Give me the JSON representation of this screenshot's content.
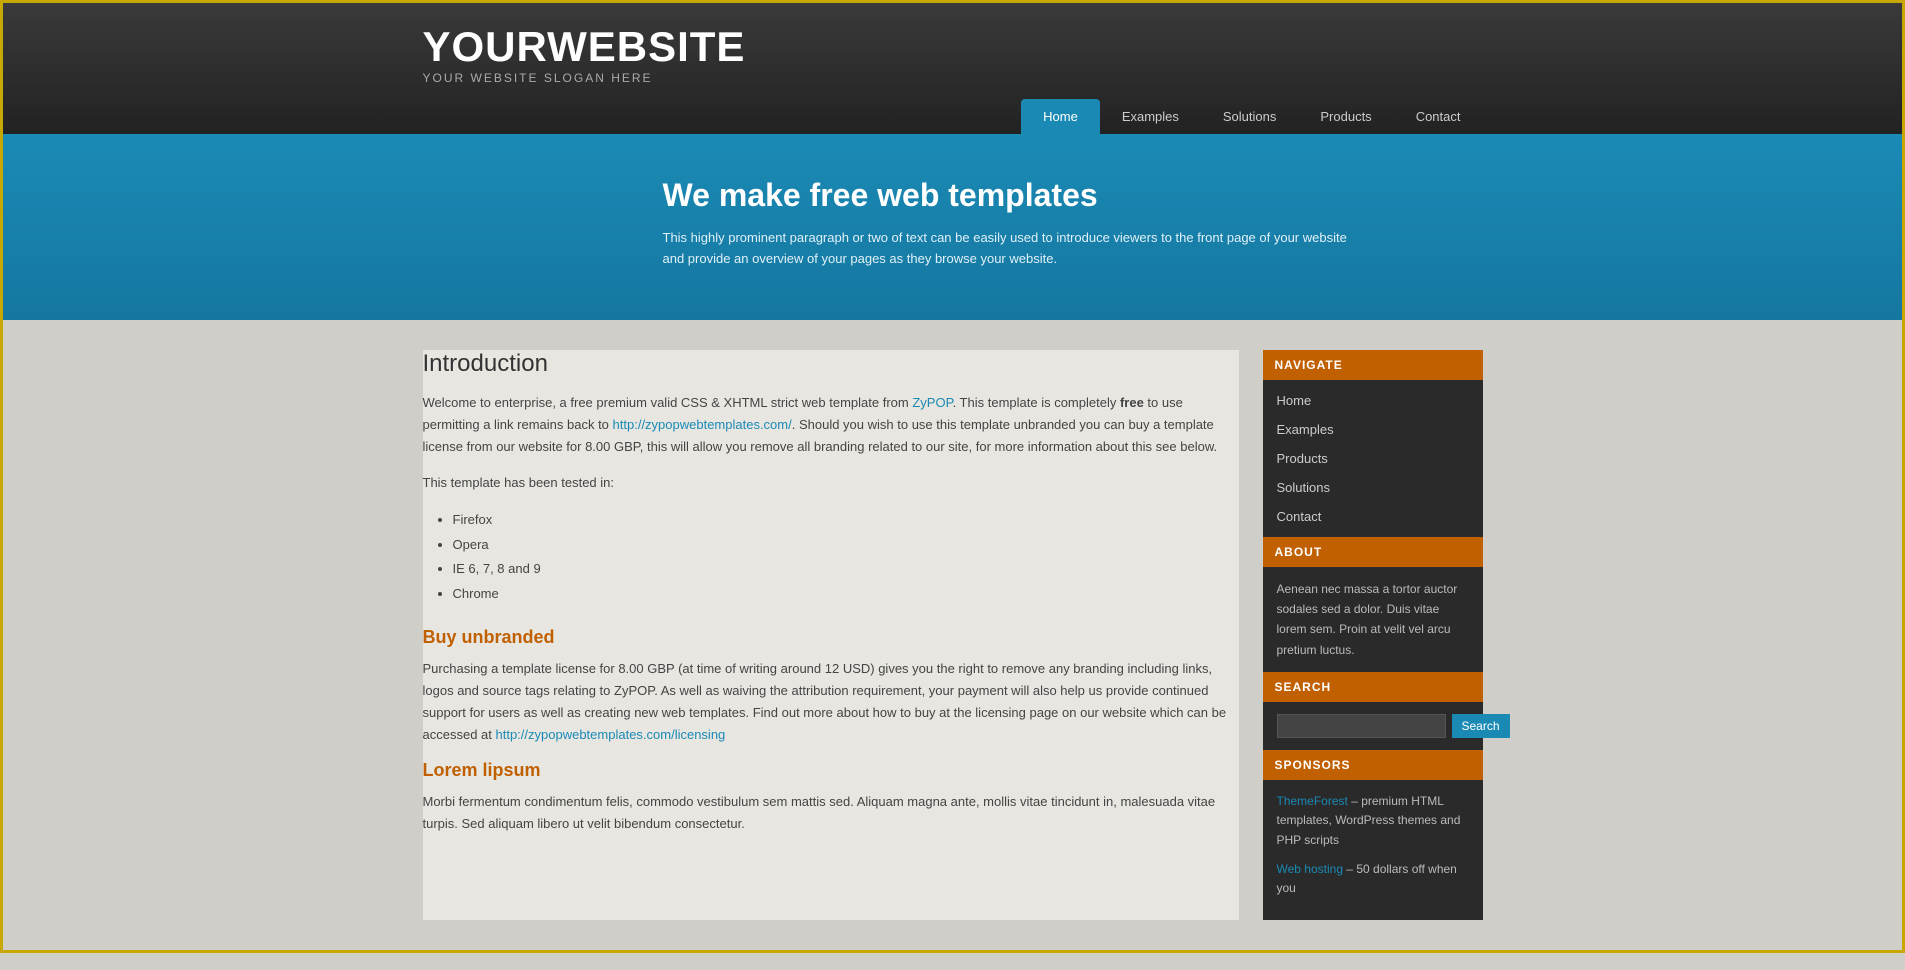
{
  "site": {
    "title": "YOURWEBSITE",
    "slogan": "YOUR WEBSITE SLOGAN HERE"
  },
  "nav": {
    "items": [
      {
        "label": "Home",
        "active": true
      },
      {
        "label": "Examples",
        "active": false
      },
      {
        "label": "Solutions",
        "active": false
      },
      {
        "label": "Products",
        "active": false
      },
      {
        "label": "Contact",
        "active": false
      }
    ]
  },
  "hero": {
    "title": "We make free web templates",
    "text": "This highly prominent paragraph or two of text can be easily used to introduce viewers to the front page of your website and provide an overview of your pages as they browse your website."
  },
  "content": {
    "intro_heading": "Introduction",
    "intro_p1_prefix": "Welcome to enterprise, a free premium valid CSS & XHTML strict web template from ",
    "intro_link1_text": "ZyPOP",
    "intro_link1_url": "http://zypop.com",
    "intro_p1_mid": ". This template is completely ",
    "intro_bold": "free",
    "intro_p1_mid2": " to use permitting a link remains back to ",
    "intro_link2_text": "http://zypopwebtemplates.com/",
    "intro_link2_url": "http://zypopwebtemplates.com/",
    "intro_p1_end": ". Should you wish to use this template unbranded you can buy a template license from our website for 8.00 GBP, this will allow you remove all branding related to our site, for more information about this see below.",
    "tested_label": "This template has been tested in:",
    "tested_items": [
      "Firefox",
      "Opera",
      "IE 6, 7, 8 and 9",
      "Chrome"
    ],
    "buy_heading": "Buy unbranded",
    "buy_text": "Purchasing a template license for 8.00 GBP (at time of writing around 12 USD) gives you the right to remove any branding including links, logos and source tags relating to ZyPOP. As well as waiving the attribution requirement, your payment will also help us provide continued support for users as well as creating new web templates. Find out more about how to buy at the licensing page on our website which can be accessed at ",
    "buy_link_text": "http://zypopwebtemplates.com/licensing",
    "buy_link_url": "http://zypopwebtemplates.com/licensing",
    "lorem_heading": "Lorem lipsum",
    "lorem_text": "Morbi fermentum condimentum felis, commodo vestibulum sem mattis sed. Aliquam magna ante, mollis vitae tincidunt in, malesuada vitae turpis. Sed aliquam libero ut velit bibendum consectetur."
  },
  "sidebar": {
    "navigate_header": "NAVIGATE",
    "nav_items": [
      "Home",
      "Examples",
      "Products",
      "Solutions",
      "Contact"
    ],
    "about_header": "ABOUT",
    "about_text": "Aenean nec massa a tortor auctor sodales sed a dolor. Duis vitae lorem sem. Proin at velit vel arcu pretium luctus.",
    "search_header": "SEARCH",
    "search_placeholder": "",
    "search_button": "Search",
    "sponsors_header": "SPONSORS",
    "sponsor1_link": "ThemeForest",
    "sponsor1_desc": " – premium HTML templates, WordPress themes and PHP scripts",
    "sponsor2_link": "Web hosting",
    "sponsor2_desc": " – 50 dollars off when you"
  }
}
